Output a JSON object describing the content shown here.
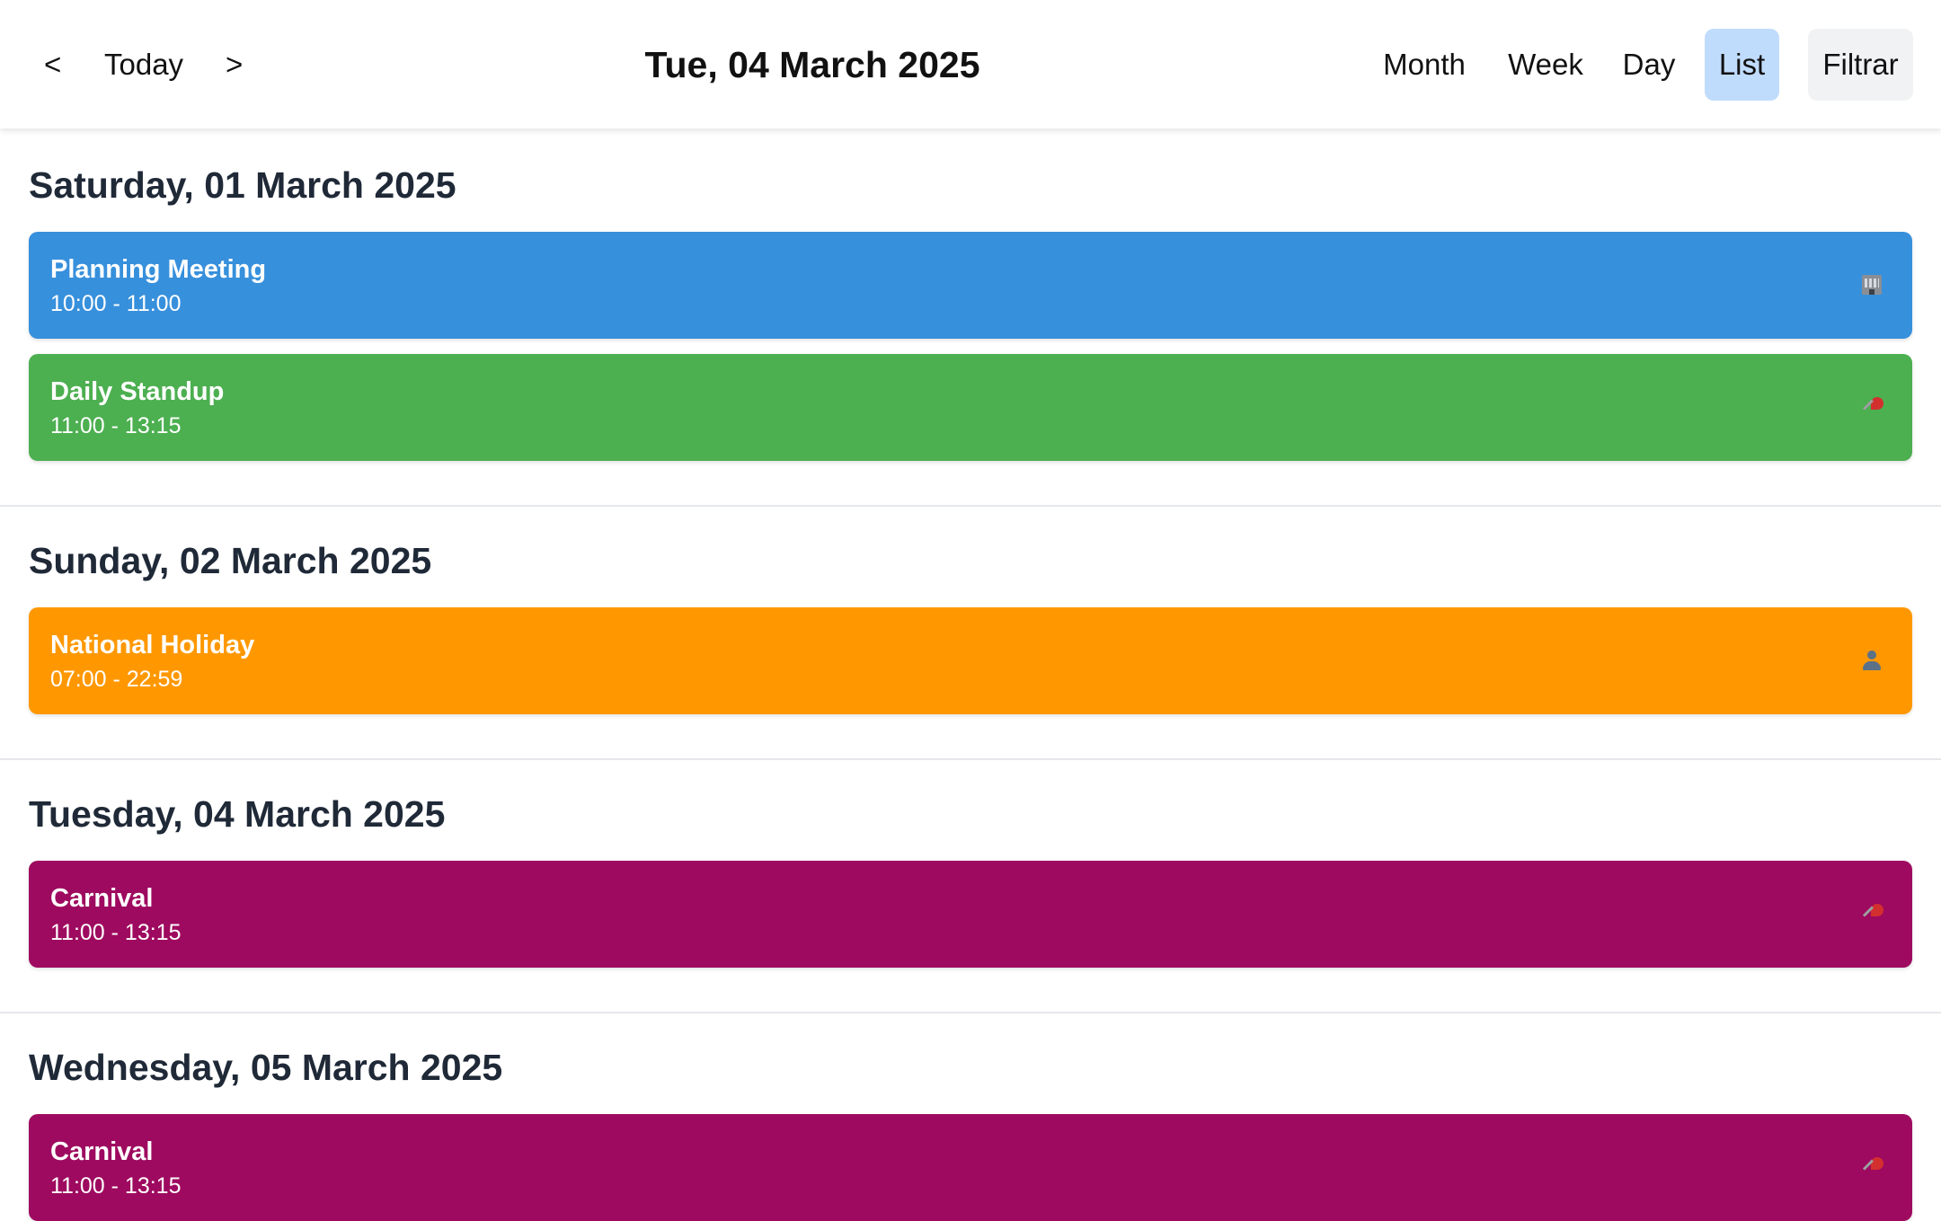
{
  "toolbar": {
    "prev_label": "<",
    "today_label": "Today",
    "next_label": ">",
    "current_date": "Tue, 04 March 2025",
    "views": [
      "Month",
      "Week",
      "Day",
      "List"
    ],
    "active_view": "List",
    "filter_label": "Filtrar",
    "active_view_color": "#c0dcfd"
  },
  "days": [
    {
      "heading": "Saturday, 01 March 2025",
      "events": [
        {
          "title": "Planning Meeting",
          "time": "10:00 - 11:00",
          "color": "#3790dc",
          "icon": "building-icon"
        },
        {
          "title": "Daily Standup",
          "time": "11:00 - 13:15",
          "color": "#4caf50",
          "icon": "pushpin-icon"
        }
      ]
    },
    {
      "heading": "Sunday, 02 March 2025",
      "events": [
        {
          "title": "National Holiday",
          "time": "07:00 - 22:59",
          "color": "#ff9800",
          "icon": "user-icon"
        }
      ]
    },
    {
      "heading": "Tuesday, 04 March 2025",
      "events": [
        {
          "title": "Carnival",
          "time": "11:00 - 13:15",
          "color": "#9e0a5f",
          "icon": "pushpin-icon"
        }
      ]
    },
    {
      "heading": "Wednesday, 05 March 2025",
      "events": [
        {
          "title": "Carnival",
          "time": "11:00 - 13:15",
          "color": "#9e0a5f",
          "icon": "pushpin-icon"
        }
      ]
    }
  ]
}
